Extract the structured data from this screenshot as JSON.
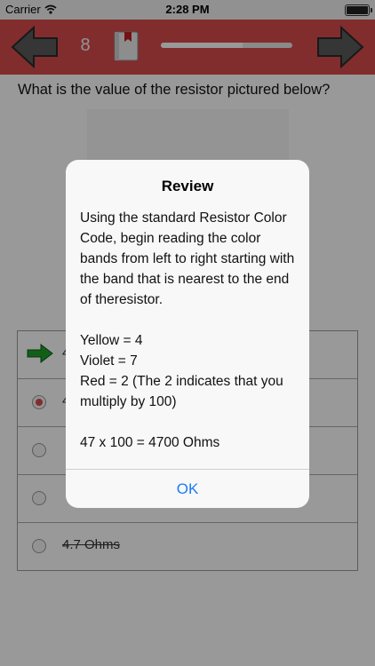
{
  "status_bar": {
    "carrier": "Carrier",
    "time": "2:28 PM"
  },
  "toolbar": {
    "question_number": "8",
    "progress_fraction": 0.62
  },
  "question": {
    "text": "What is the value of the resistor pictured below?"
  },
  "answers": [
    {
      "text": "4",
      "state": "correct"
    },
    {
      "text": "4",
      "state": "selected"
    },
    {
      "text": "",
      "state": "struck"
    },
    {
      "text": "",
      "state": "struck"
    },
    {
      "text": "4.7 Ohms",
      "state": "struck"
    }
  ],
  "review_dialog": {
    "title": "Review",
    "paragraph1": "Using the standard Resistor Color Code, begin reading the color bands from left to right starting with the band that is nearest to the end of theresistor.",
    "line_yellow": "Yellow = 4",
    "line_violet": "Violet = 7",
    "line_red": "Red = 2 (The 2 indicates that you multiply by 100)",
    "result": "47 x 100 = 4700 Ohms",
    "ok_label": "OK"
  },
  "colors": {
    "toolbar": "#d84b4b",
    "accent_link": "#1a7cf5",
    "arrow_green": "#1e9e2a"
  }
}
